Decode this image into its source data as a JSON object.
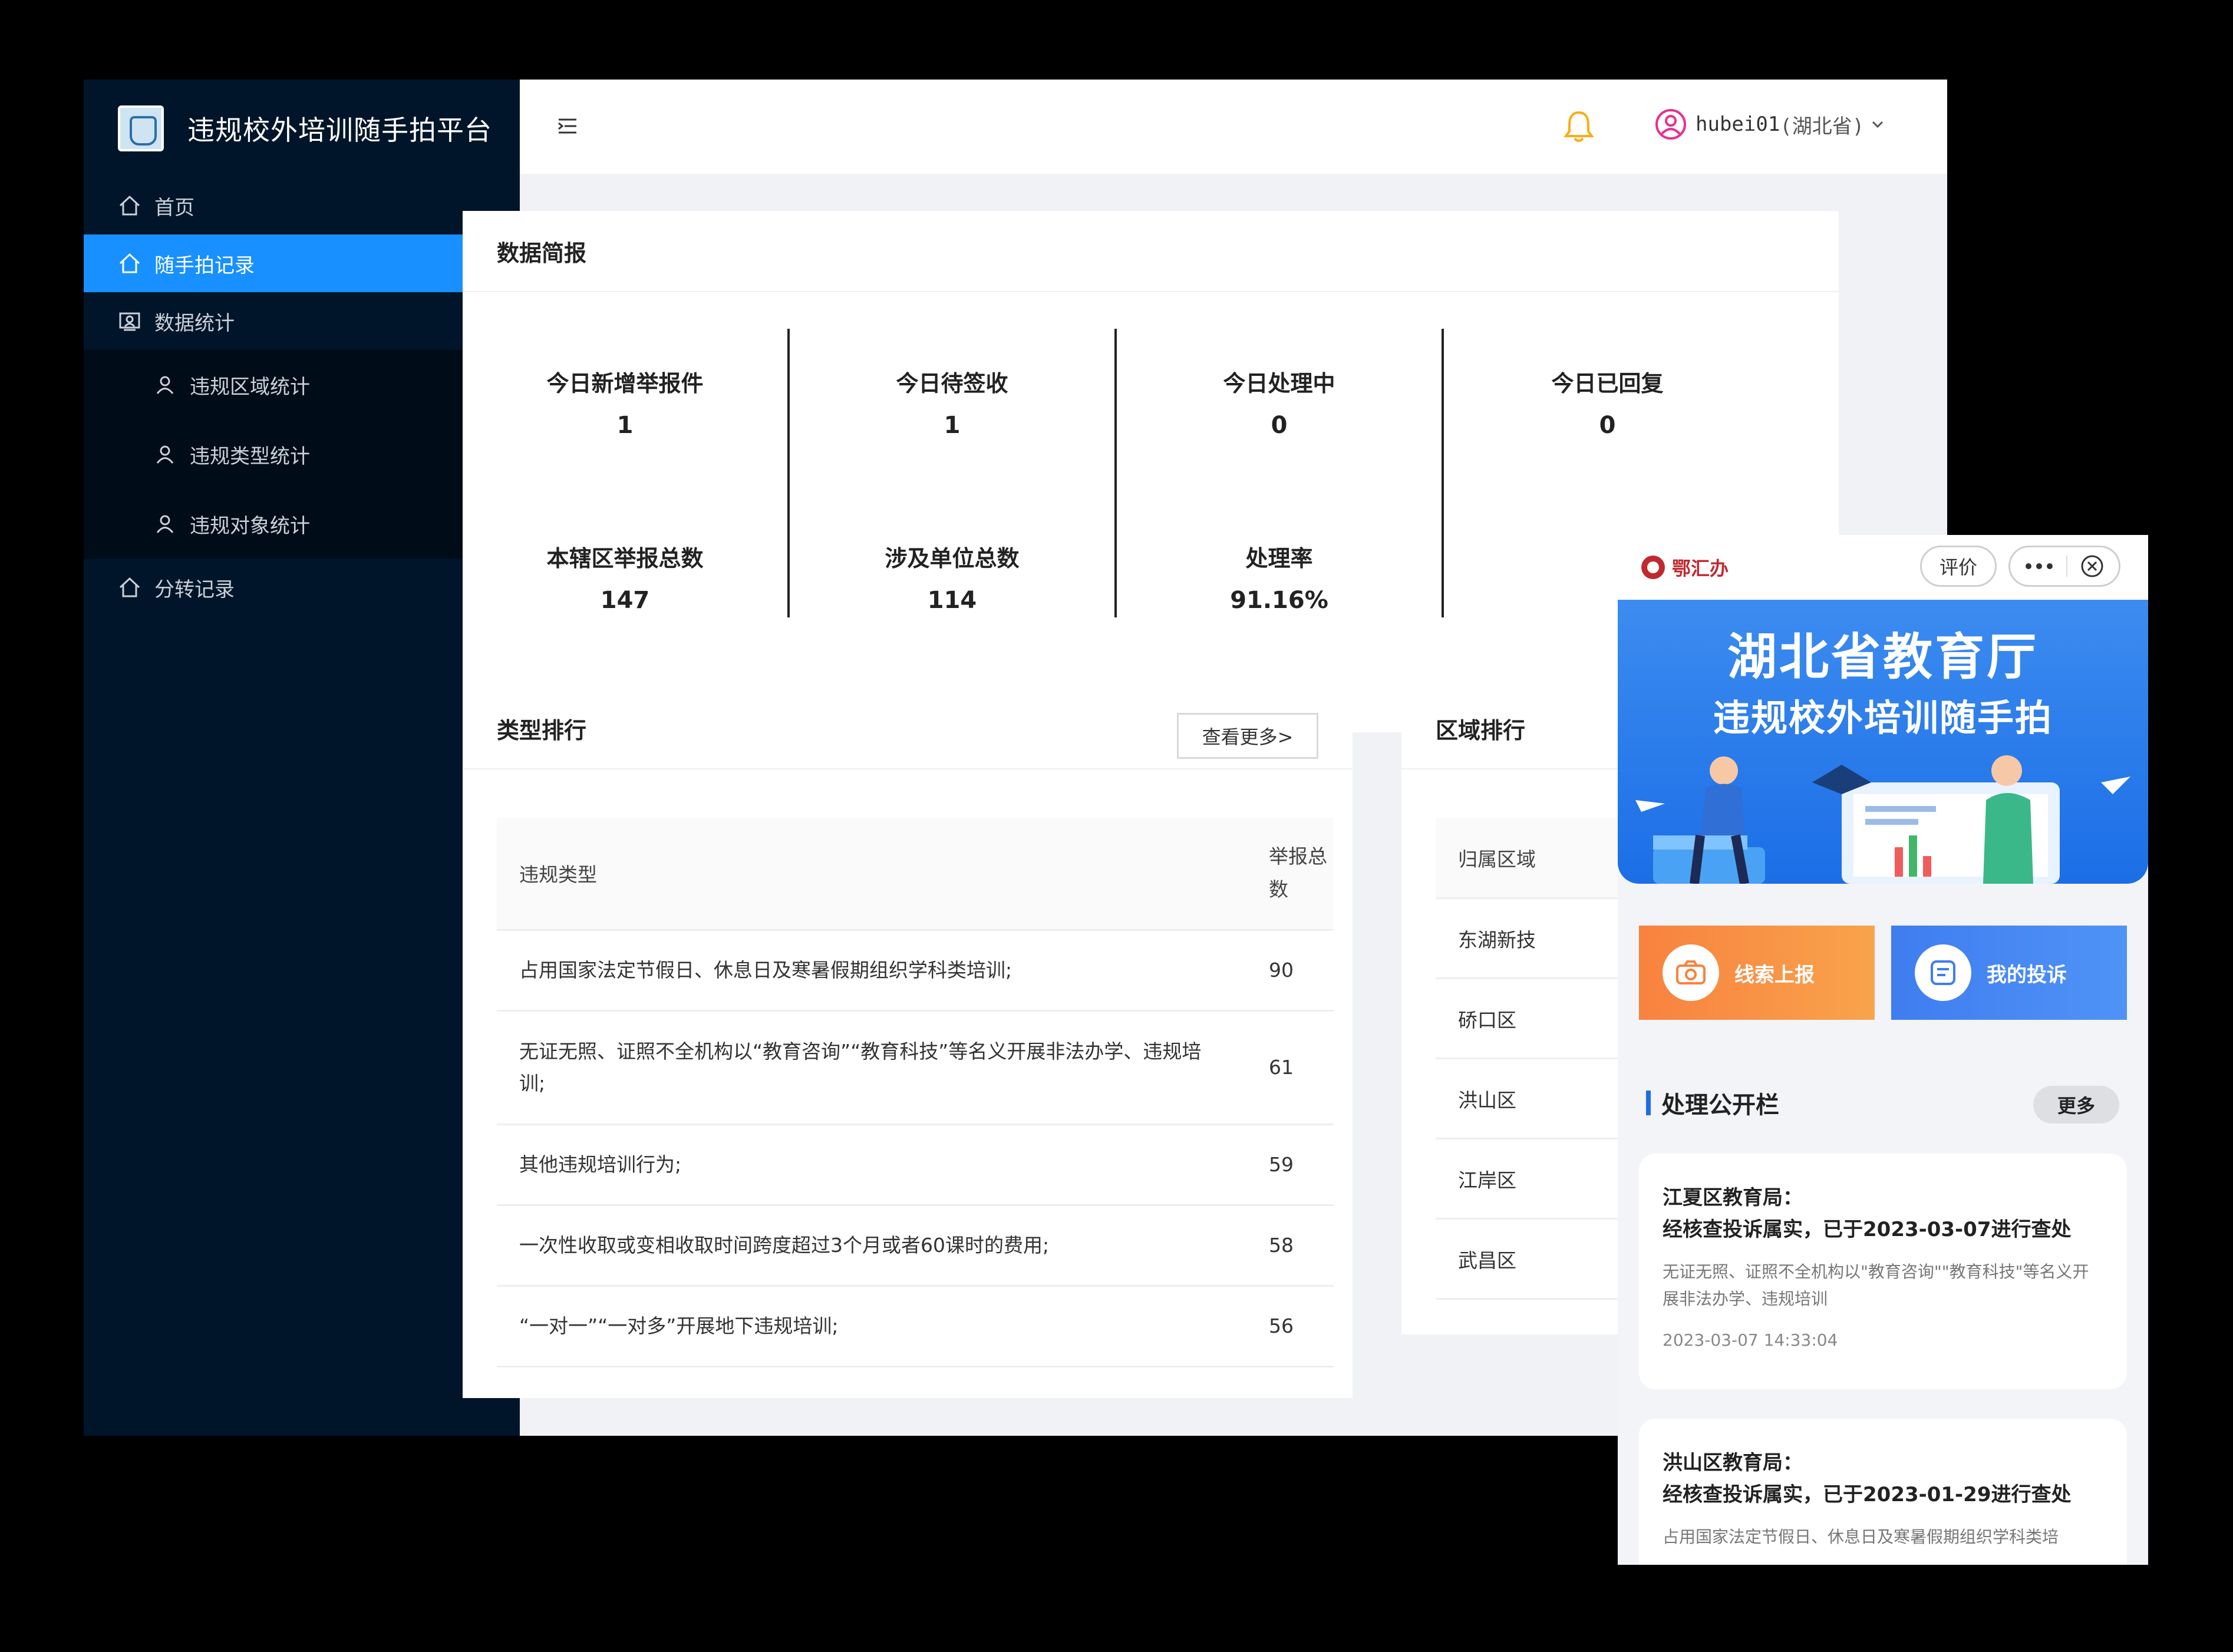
{
  "app": {
    "title": "违规校外培训随手拍平台"
  },
  "sidebar": {
    "items": [
      {
        "label": "首页",
        "icon": "home-icon"
      },
      {
        "label": "随手拍记录",
        "icon": "home-icon",
        "active": true
      },
      {
        "label": "数据统计",
        "icon": "chart-icon",
        "expanded": true
      },
      {
        "label": "违规区域统计",
        "icon": "user-icon"
      },
      {
        "label": "违规类型统计",
        "icon": "user-icon"
      },
      {
        "label": "违规对象统计",
        "icon": "user-icon"
      },
      {
        "label": "分转记录",
        "icon": "home-icon"
      }
    ]
  },
  "header": {
    "username": "hubei01",
    "province": "(湖北省)"
  },
  "overview": {
    "title": "数据简报",
    "stats": [
      {
        "label": "今日新增举报件",
        "value": "1"
      },
      {
        "label": "今日待签收",
        "value": "1"
      },
      {
        "label": "今日处理中",
        "value": "0"
      },
      {
        "label": "今日已回复",
        "value": "0"
      },
      {
        "label": "本辖区举报总数",
        "value": "147"
      },
      {
        "label": "涉及单位总数",
        "value": "114"
      },
      {
        "label": "处理率",
        "value": "91.16%"
      }
    ]
  },
  "types": {
    "title": "类型排行",
    "more_label": "查看更多>",
    "col_type": "违规类型",
    "col_count": "举报总数",
    "rows": [
      {
        "type": "占用国家法定节假日、休息日及寒暑假期组织学科类培训;",
        "count": "90"
      },
      {
        "type": "无证无照、证照不全机构以“教育咨询”“教育科技”等名义开展非法办学、违规培训;",
        "count": "61"
      },
      {
        "type": "其他违规培训行为;",
        "count": "59"
      },
      {
        "type": "一次性收取或变相收取时间跨度超过3个月或者60课时的费用;",
        "count": "58"
      },
      {
        "type": "“一对一”“一对多”开展地下违规培训;",
        "count": "56"
      }
    ]
  },
  "regions": {
    "title": "区域排行",
    "header": "归属区域",
    "rows": [
      "东湖新技",
      "硚口区",
      "洪山区",
      "江岸区",
      "武昌区"
    ]
  },
  "phone": {
    "brand": "鄂汇办",
    "rate_label": "评价",
    "banner_title": "湖北省教育厅",
    "banner_subtitle": "违规校外培训随手拍",
    "btn_report": "线索上报",
    "btn_mine": "我的投诉",
    "public_title": "处理公开栏",
    "public_more": "更多",
    "notices": [
      {
        "org": "江夏区教育局：",
        "result": "经核查投诉属实，已于2023-03-07进行查处",
        "desc": "无证无照、证照不全机构以\"教育咨询\"\"教育科技\"等名义开展非法办学、违规培训",
        "time": "2023-03-07 14:33:04"
      },
      {
        "org": "洪山区教育局：",
        "result": "经核查投诉属实，已于2023-01-29进行查处",
        "desc": "占用国家法定节假日、休息日及寒暑假期组织学科类培",
        "time": ""
      }
    ]
  },
  "colors": {
    "sidebar_bg": "#001529",
    "active": "#1890ff",
    "bell": "#faad14",
    "phone_blue": "#1c6ee6",
    "phone_orange": "#f8823f"
  }
}
